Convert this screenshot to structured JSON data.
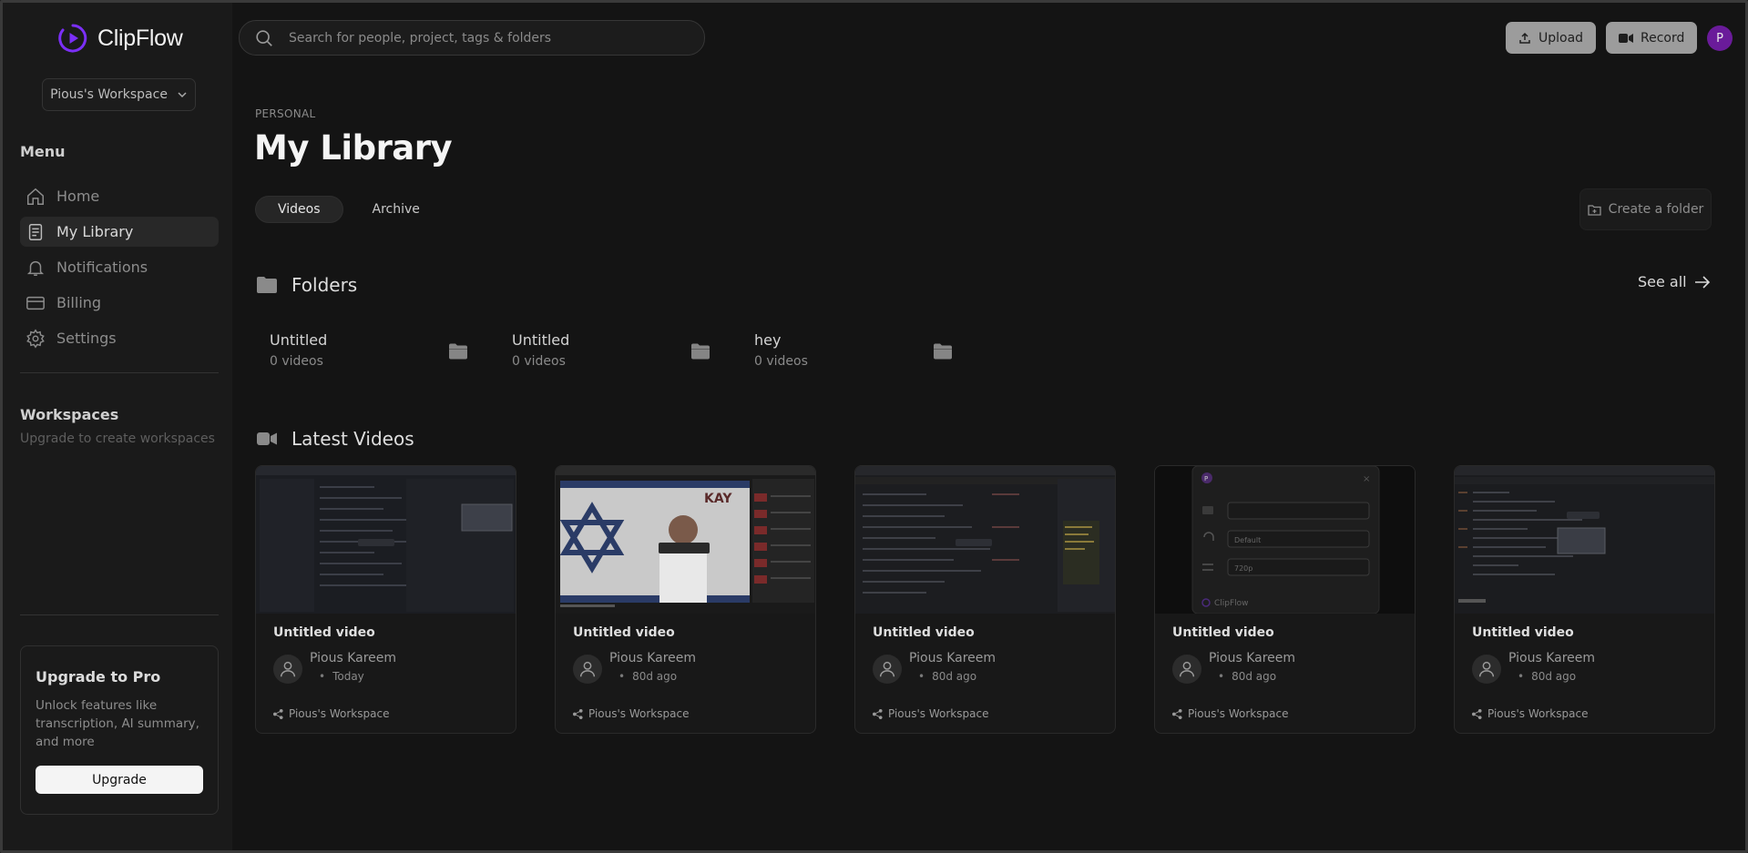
{
  "app": {
    "name": "ClipFlow",
    "accent": "#7b2ff7"
  },
  "sidebar": {
    "workspace_select": "Pious's Workspace",
    "menu_title": "Menu",
    "items": [
      {
        "label": "Home",
        "icon": "home-icon"
      },
      {
        "label": "My Library",
        "icon": "document-icon",
        "active": true
      },
      {
        "label": "Notifications",
        "icon": "bell-icon"
      },
      {
        "label": "Billing",
        "icon": "card-icon"
      },
      {
        "label": "Settings",
        "icon": "gear-icon"
      }
    ],
    "workspaces_title": "Workspaces",
    "workspaces_sub": "Upgrade to create workspaces",
    "upgrade": {
      "title": "Upgrade to Pro",
      "text": "Unlock features like transcription, AI summary, and more",
      "button": "Upgrade"
    }
  },
  "topbar": {
    "search_placeholder": "Search for people, project, tags & folders",
    "upload_label": "Upload",
    "record_label": "Record",
    "avatar_initial": "P"
  },
  "main": {
    "crumb": "PERSONAL",
    "title": "My Library",
    "tabs": [
      "Videos",
      "Archive"
    ],
    "create_folder": "Create a folder",
    "folders_title": "Folders",
    "see_all": "See all",
    "folders": [
      {
        "name": "Untitled",
        "count": "0 videos"
      },
      {
        "name": "Untitled",
        "count": "0 videos"
      },
      {
        "name": "hey",
        "count": "0 videos"
      }
    ],
    "latest_title": "Latest Videos",
    "videos": [
      {
        "title": "Untitled video",
        "author": "Pious Kareem",
        "date": "Today",
        "workspace": "Pious's Workspace"
      },
      {
        "title": "Untitled video",
        "author": "Pious Kareem",
        "date": "80d ago",
        "workspace": "Pious's Workspace"
      },
      {
        "title": "Untitled video",
        "author": "Pious Kareem",
        "date": "80d ago",
        "workspace": "Pious's Workspace"
      },
      {
        "title": "Untitled video",
        "author": "Pious Kareem",
        "date": "80d ago",
        "workspace": "Pious's Workspace"
      },
      {
        "title": "Untitled video",
        "author": "Pious Kareem",
        "date": "80d ago",
        "workspace": "Pious's Workspace"
      }
    ],
    "thumb4": {
      "opt1": "Default",
      "opt2": "720p",
      "brand": "ClipFlow",
      "avatar_initial": "P"
    },
    "thumb2": {
      "banner": "KAY"
    }
  }
}
